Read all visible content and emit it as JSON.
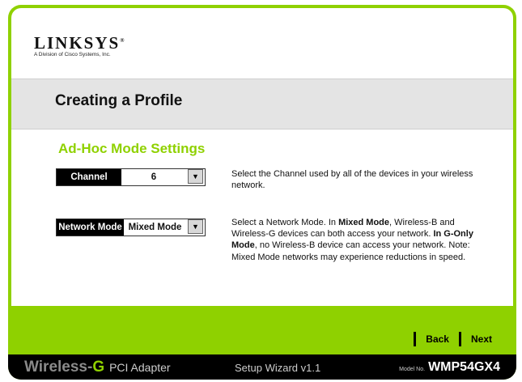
{
  "brand": {
    "name": "LINKSYS",
    "tagline": "A Division of Cisco Systems, Inc."
  },
  "page": {
    "title": "Creating a Profile",
    "section_title": "Ad-Hoc Mode Settings"
  },
  "channel": {
    "label": "Channel",
    "value": "6",
    "description": "Select the Channel used by all of the devices in your wireless network."
  },
  "network_mode": {
    "label": "Network Mode",
    "value": "Mixed Mode",
    "desc_1": "Select a Network Mode. In ",
    "desc_1_bold": "Mixed Mode",
    "desc_2": ", Wireless-B and Wireless-G devices can both access your network. ",
    "desc_2_bold": "In G-Only Mode",
    "desc_3": ", no Wireless-B device can access your network. Note: Mixed Mode networks may experience reductions in speed."
  },
  "nav": {
    "back": "Back",
    "next": "Next"
  },
  "footer": {
    "product_prefix": "Wireless-",
    "product_g": "G",
    "product_type": "PCI Adapter",
    "wizard": "Setup Wizard  v1.1",
    "model_label": "Model No.",
    "model": "WMP54GX4"
  },
  "colors": {
    "accent": "#8fd100",
    "band": "#e4e4e4",
    "footer": "#000000"
  },
  "icons": {
    "dropdown": "chevron-down-icon"
  }
}
